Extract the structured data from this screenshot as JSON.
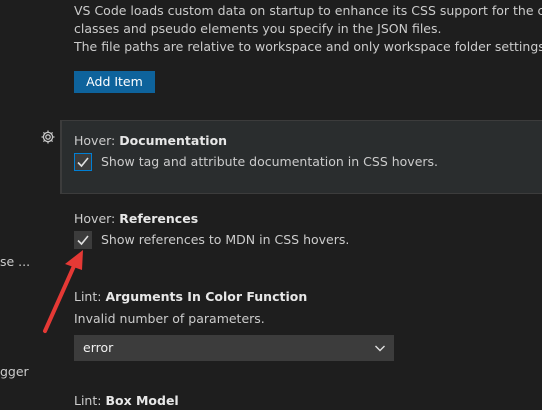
{
  "description_lines": [
    "VS Code loads custom data on startup to enhance its CSS support for the custom",
    "classes and pseudo elements you specify in the JSON files.",
    "The file paths are relative to workspace and only workspace folder settings are cor"
  ],
  "add_item_label": "Add Item",
  "sidebar_fragments": {
    "frag_1": "se ...",
    "frag_2": "gger"
  },
  "hover_documentation": {
    "category": "Hover: ",
    "key": "Documentation",
    "checkbox_label": "Show tag and attribute documentation in CSS hovers.",
    "checked": true
  },
  "hover_references": {
    "category": "Hover: ",
    "key": "References",
    "checkbox_label": "Show references to MDN in CSS hovers.",
    "checked": true
  },
  "lint_args": {
    "category": "Lint: ",
    "key": "Arguments In Color Function",
    "description": "Invalid number of parameters.",
    "selected_value": "error"
  },
  "lint_box_model": {
    "category": "Lint: ",
    "key": "Box Model"
  },
  "icons": {
    "gear": "gear-icon",
    "check": "check-icon",
    "chevron": "chevron-down-icon"
  },
  "colors": {
    "background": "#1e1e1e",
    "button": "#0e639c",
    "focus_border": "#007fd4",
    "annotation_arrow": "#e53935"
  }
}
